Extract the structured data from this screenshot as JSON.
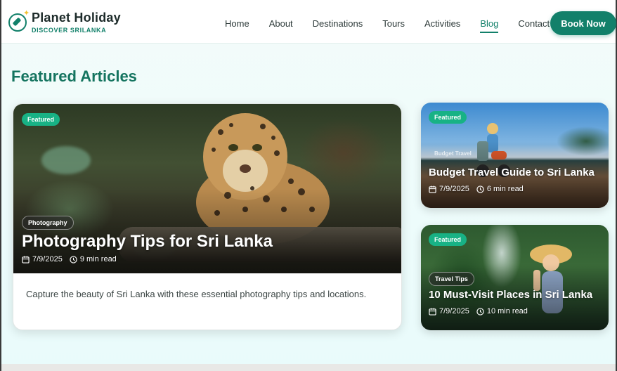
{
  "brand": {
    "name": "Planet Holiday",
    "tagline": "DISCOVER SRILANKA"
  },
  "nav": {
    "items": [
      {
        "label": "Home"
      },
      {
        "label": "About"
      },
      {
        "label": "Destinations"
      },
      {
        "label": "Tours"
      },
      {
        "label": "Activities"
      },
      {
        "label": "Blog",
        "active": true
      },
      {
        "label": "Contact"
      }
    ],
    "cta": "Book Now"
  },
  "section": {
    "title": "Featured Articles"
  },
  "main_article": {
    "badge": "Featured",
    "category": "Photography",
    "title": "Photography Tips for Sri Lanka",
    "date": "7/9/2025",
    "read_time": "9 min read",
    "excerpt": "Capture the beauty of Sri Lanka with these essential photography tips and locations."
  },
  "side_articles": [
    {
      "badge": "Featured",
      "category": "Budget Travel",
      "title": "Budget Travel Guide to Sri Lanka",
      "date": "7/9/2025",
      "read_time": "6 min read"
    },
    {
      "badge": "Featured",
      "category": "Travel Tips",
      "title": "10 Must-Visit Places in Sri Lanka",
      "date": "7/9/2025",
      "read_time": "10 min read"
    }
  ],
  "colors": {
    "brand": "#12806a",
    "badge": "#18b285",
    "title": "#14745f"
  },
  "icons": {
    "logo": "compass-icon",
    "date": "calendar-icon",
    "time": "clock-icon"
  }
}
